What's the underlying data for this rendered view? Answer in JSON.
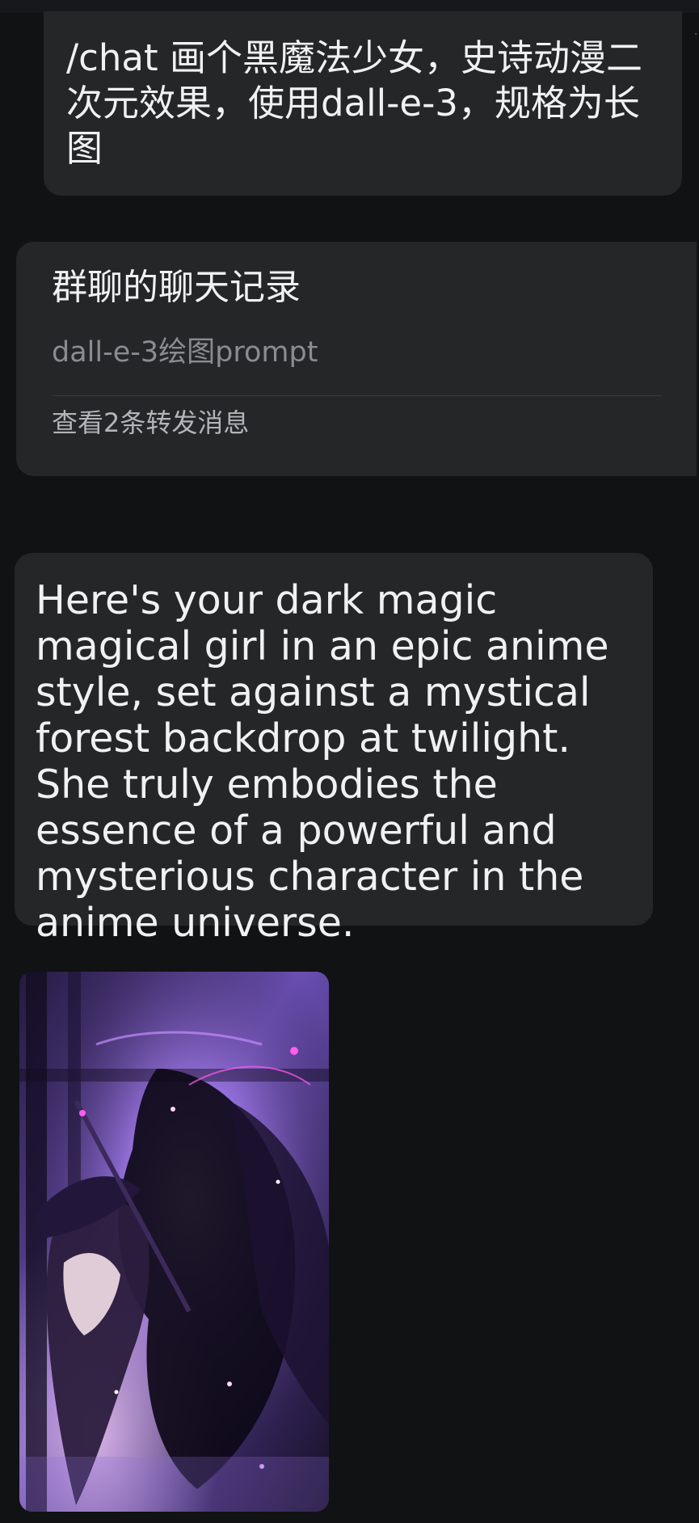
{
  "command_message": {
    "text": "/chat 画个黑魔法少女，史诗动漫二次元效果，使用dall-e-3，规格为长图"
  },
  "forward_card": {
    "title": "群聊的聊天记录",
    "preview": "dall-e-3绘图prompt",
    "footer": "查看2条转发消息"
  },
  "reply_message": {
    "text": "Here's your dark magic magical girl in an epic anime style, set against a mystical forest backdrop at twilight. She truly embodies the essence of a powerful and mysterious character in the anime universe."
  },
  "image_message": {
    "icon": "generated-image",
    "colors": {
      "sky": "#6b4fb3",
      "glow": "#e7a6ff",
      "dark": "#160f24",
      "spark": "#ff5cf0"
    }
  },
  "colors": {
    "background": "#111214",
    "bubble": "#252628",
    "text": "#f1f1f2",
    "muted_text": "#8b8c90",
    "divider": "#3a3b3e"
  }
}
